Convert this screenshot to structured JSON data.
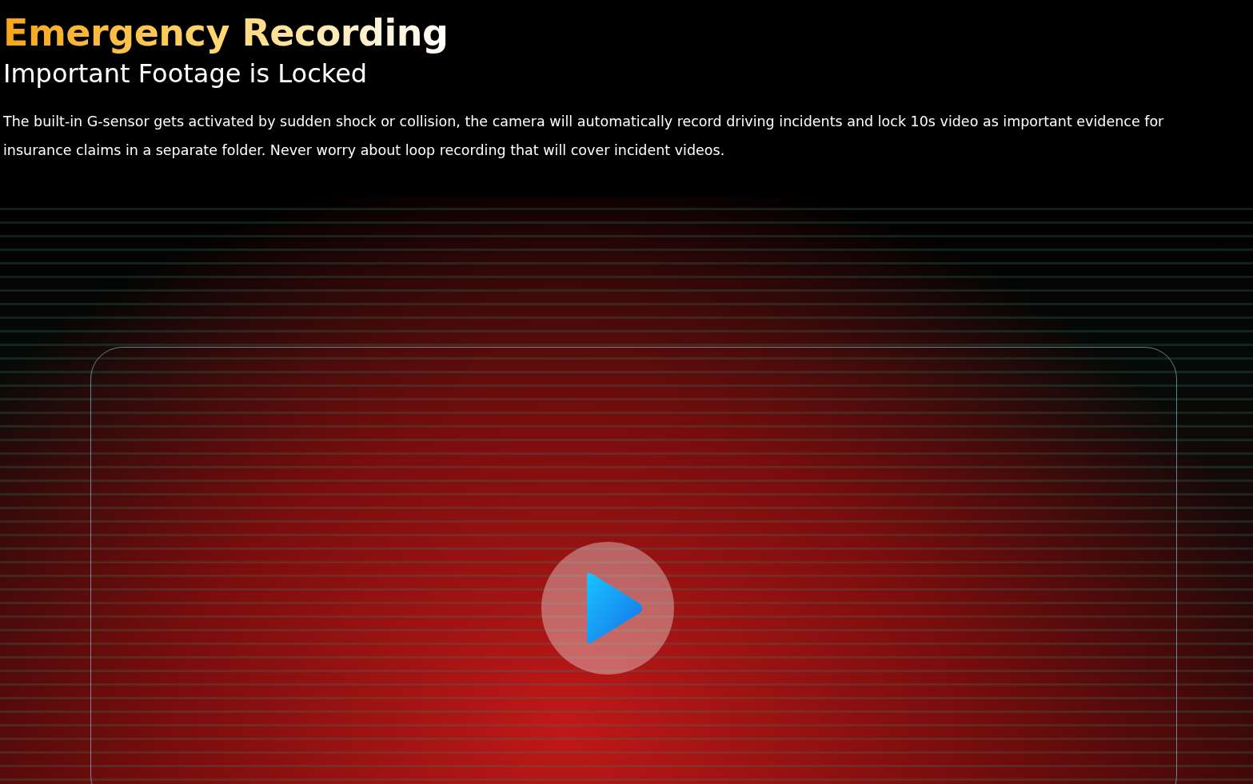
{
  "heading": "Emergency Recording",
  "subheading": "Important Footage is Locked",
  "description": "The built-in G-sensor gets activated by sudden shock or collision, the camera will automatically record driving incidents and lock 10s video as important evidence for insurance claims in a separate folder. Never worry about loop recording that will cover incident videos."
}
